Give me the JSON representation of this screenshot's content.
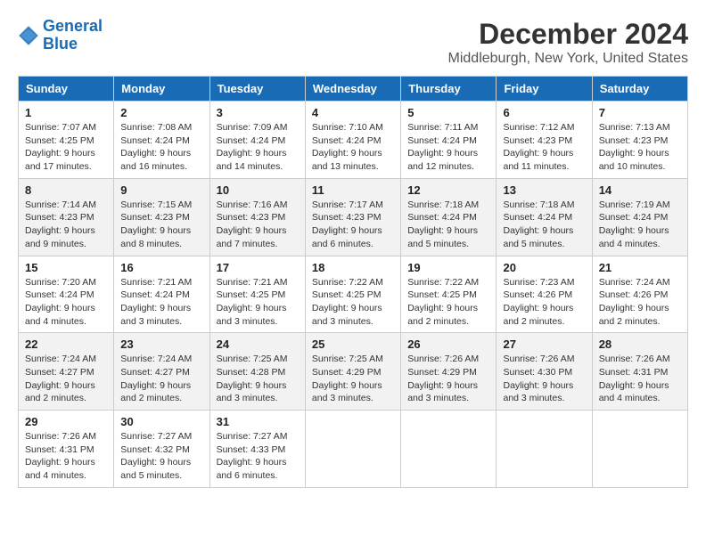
{
  "logo": {
    "line1": "General",
    "line2": "Blue"
  },
  "title": "December 2024",
  "subtitle": "Middleburgh, New York, United States",
  "days_header": [
    "Sunday",
    "Monday",
    "Tuesday",
    "Wednesday",
    "Thursday",
    "Friday",
    "Saturday"
  ],
  "weeks": [
    [
      {
        "day": "1",
        "sunrise": "7:07 AM",
        "sunset": "4:25 PM",
        "daylight": "9 hours and 17 minutes."
      },
      {
        "day": "2",
        "sunrise": "7:08 AM",
        "sunset": "4:24 PM",
        "daylight": "9 hours and 16 minutes."
      },
      {
        "day": "3",
        "sunrise": "7:09 AM",
        "sunset": "4:24 PM",
        "daylight": "9 hours and 14 minutes."
      },
      {
        "day": "4",
        "sunrise": "7:10 AM",
        "sunset": "4:24 PM",
        "daylight": "9 hours and 13 minutes."
      },
      {
        "day": "5",
        "sunrise": "7:11 AM",
        "sunset": "4:24 PM",
        "daylight": "9 hours and 12 minutes."
      },
      {
        "day": "6",
        "sunrise": "7:12 AM",
        "sunset": "4:23 PM",
        "daylight": "9 hours and 11 minutes."
      },
      {
        "day": "7",
        "sunrise": "7:13 AM",
        "sunset": "4:23 PM",
        "daylight": "9 hours and 10 minutes."
      }
    ],
    [
      {
        "day": "8",
        "sunrise": "7:14 AM",
        "sunset": "4:23 PM",
        "daylight": "9 hours and 9 minutes."
      },
      {
        "day": "9",
        "sunrise": "7:15 AM",
        "sunset": "4:23 PM",
        "daylight": "9 hours and 8 minutes."
      },
      {
        "day": "10",
        "sunrise": "7:16 AM",
        "sunset": "4:23 PM",
        "daylight": "9 hours and 7 minutes."
      },
      {
        "day": "11",
        "sunrise": "7:17 AM",
        "sunset": "4:23 PM",
        "daylight": "9 hours and 6 minutes."
      },
      {
        "day": "12",
        "sunrise": "7:18 AM",
        "sunset": "4:24 PM",
        "daylight": "9 hours and 5 minutes."
      },
      {
        "day": "13",
        "sunrise": "7:18 AM",
        "sunset": "4:24 PM",
        "daylight": "9 hours and 5 minutes."
      },
      {
        "day": "14",
        "sunrise": "7:19 AM",
        "sunset": "4:24 PM",
        "daylight": "9 hours and 4 minutes."
      }
    ],
    [
      {
        "day": "15",
        "sunrise": "7:20 AM",
        "sunset": "4:24 PM",
        "daylight": "9 hours and 4 minutes."
      },
      {
        "day": "16",
        "sunrise": "7:21 AM",
        "sunset": "4:24 PM",
        "daylight": "9 hours and 3 minutes."
      },
      {
        "day": "17",
        "sunrise": "7:21 AM",
        "sunset": "4:25 PM",
        "daylight": "9 hours and 3 minutes."
      },
      {
        "day": "18",
        "sunrise": "7:22 AM",
        "sunset": "4:25 PM",
        "daylight": "9 hours and 3 minutes."
      },
      {
        "day": "19",
        "sunrise": "7:22 AM",
        "sunset": "4:25 PM",
        "daylight": "9 hours and 2 minutes."
      },
      {
        "day": "20",
        "sunrise": "7:23 AM",
        "sunset": "4:26 PM",
        "daylight": "9 hours and 2 minutes."
      },
      {
        "day": "21",
        "sunrise": "7:24 AM",
        "sunset": "4:26 PM",
        "daylight": "9 hours and 2 minutes."
      }
    ],
    [
      {
        "day": "22",
        "sunrise": "7:24 AM",
        "sunset": "4:27 PM",
        "daylight": "9 hours and 2 minutes."
      },
      {
        "day": "23",
        "sunrise": "7:24 AM",
        "sunset": "4:27 PM",
        "daylight": "9 hours and 2 minutes."
      },
      {
        "day": "24",
        "sunrise": "7:25 AM",
        "sunset": "4:28 PM",
        "daylight": "9 hours and 3 minutes."
      },
      {
        "day": "25",
        "sunrise": "7:25 AM",
        "sunset": "4:29 PM",
        "daylight": "9 hours and 3 minutes."
      },
      {
        "day": "26",
        "sunrise": "7:26 AM",
        "sunset": "4:29 PM",
        "daylight": "9 hours and 3 minutes."
      },
      {
        "day": "27",
        "sunrise": "7:26 AM",
        "sunset": "4:30 PM",
        "daylight": "9 hours and 3 minutes."
      },
      {
        "day": "28",
        "sunrise": "7:26 AM",
        "sunset": "4:31 PM",
        "daylight": "9 hours and 4 minutes."
      }
    ],
    [
      {
        "day": "29",
        "sunrise": "7:26 AM",
        "sunset": "4:31 PM",
        "daylight": "9 hours and 4 minutes."
      },
      {
        "day": "30",
        "sunrise": "7:27 AM",
        "sunset": "4:32 PM",
        "daylight": "9 hours and 5 minutes."
      },
      {
        "day": "31",
        "sunrise": "7:27 AM",
        "sunset": "4:33 PM",
        "daylight": "9 hours and 6 minutes."
      },
      null,
      null,
      null,
      null
    ]
  ],
  "labels": {
    "sunrise": "Sunrise:",
    "sunset": "Sunset:",
    "daylight": "Daylight:"
  }
}
